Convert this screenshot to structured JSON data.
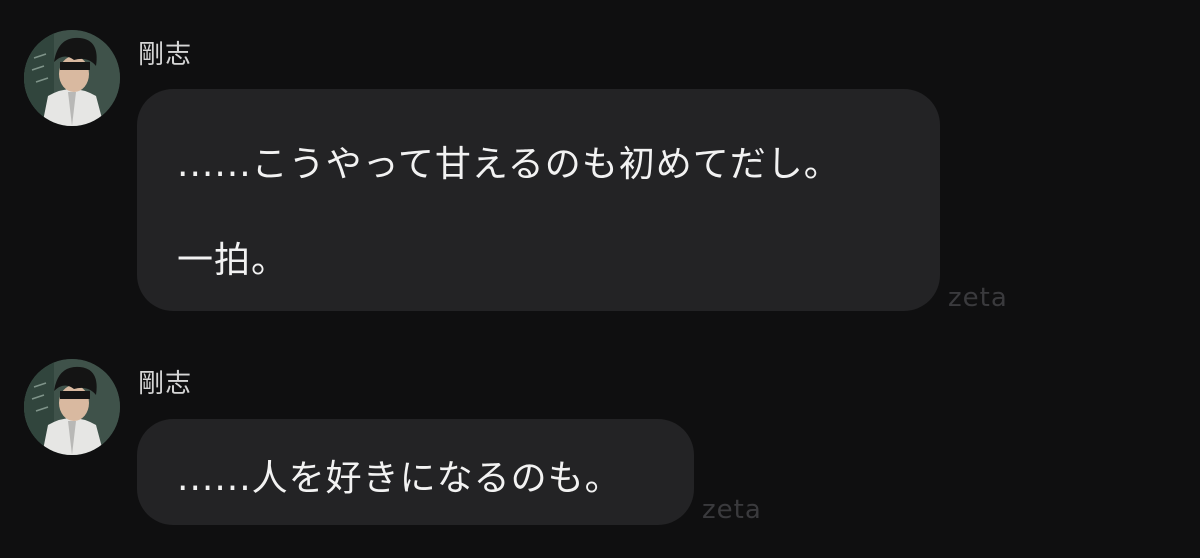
{
  "messages": [
    {
      "sender": "剛志",
      "lines": [
        "......こうやって甘えるのも初めてだし。",
        "",
        "一拍。"
      ],
      "brand": "zeta"
    },
    {
      "sender": "剛志",
      "lines": [
        "......人を好きになるのも。"
      ],
      "brand": "zeta"
    }
  ],
  "colors": {
    "background": "#0f0f10",
    "bubble": "#232325",
    "text": "#f2f2f2",
    "sender": "#d6d6d6",
    "brand": "#3a3a3d"
  }
}
